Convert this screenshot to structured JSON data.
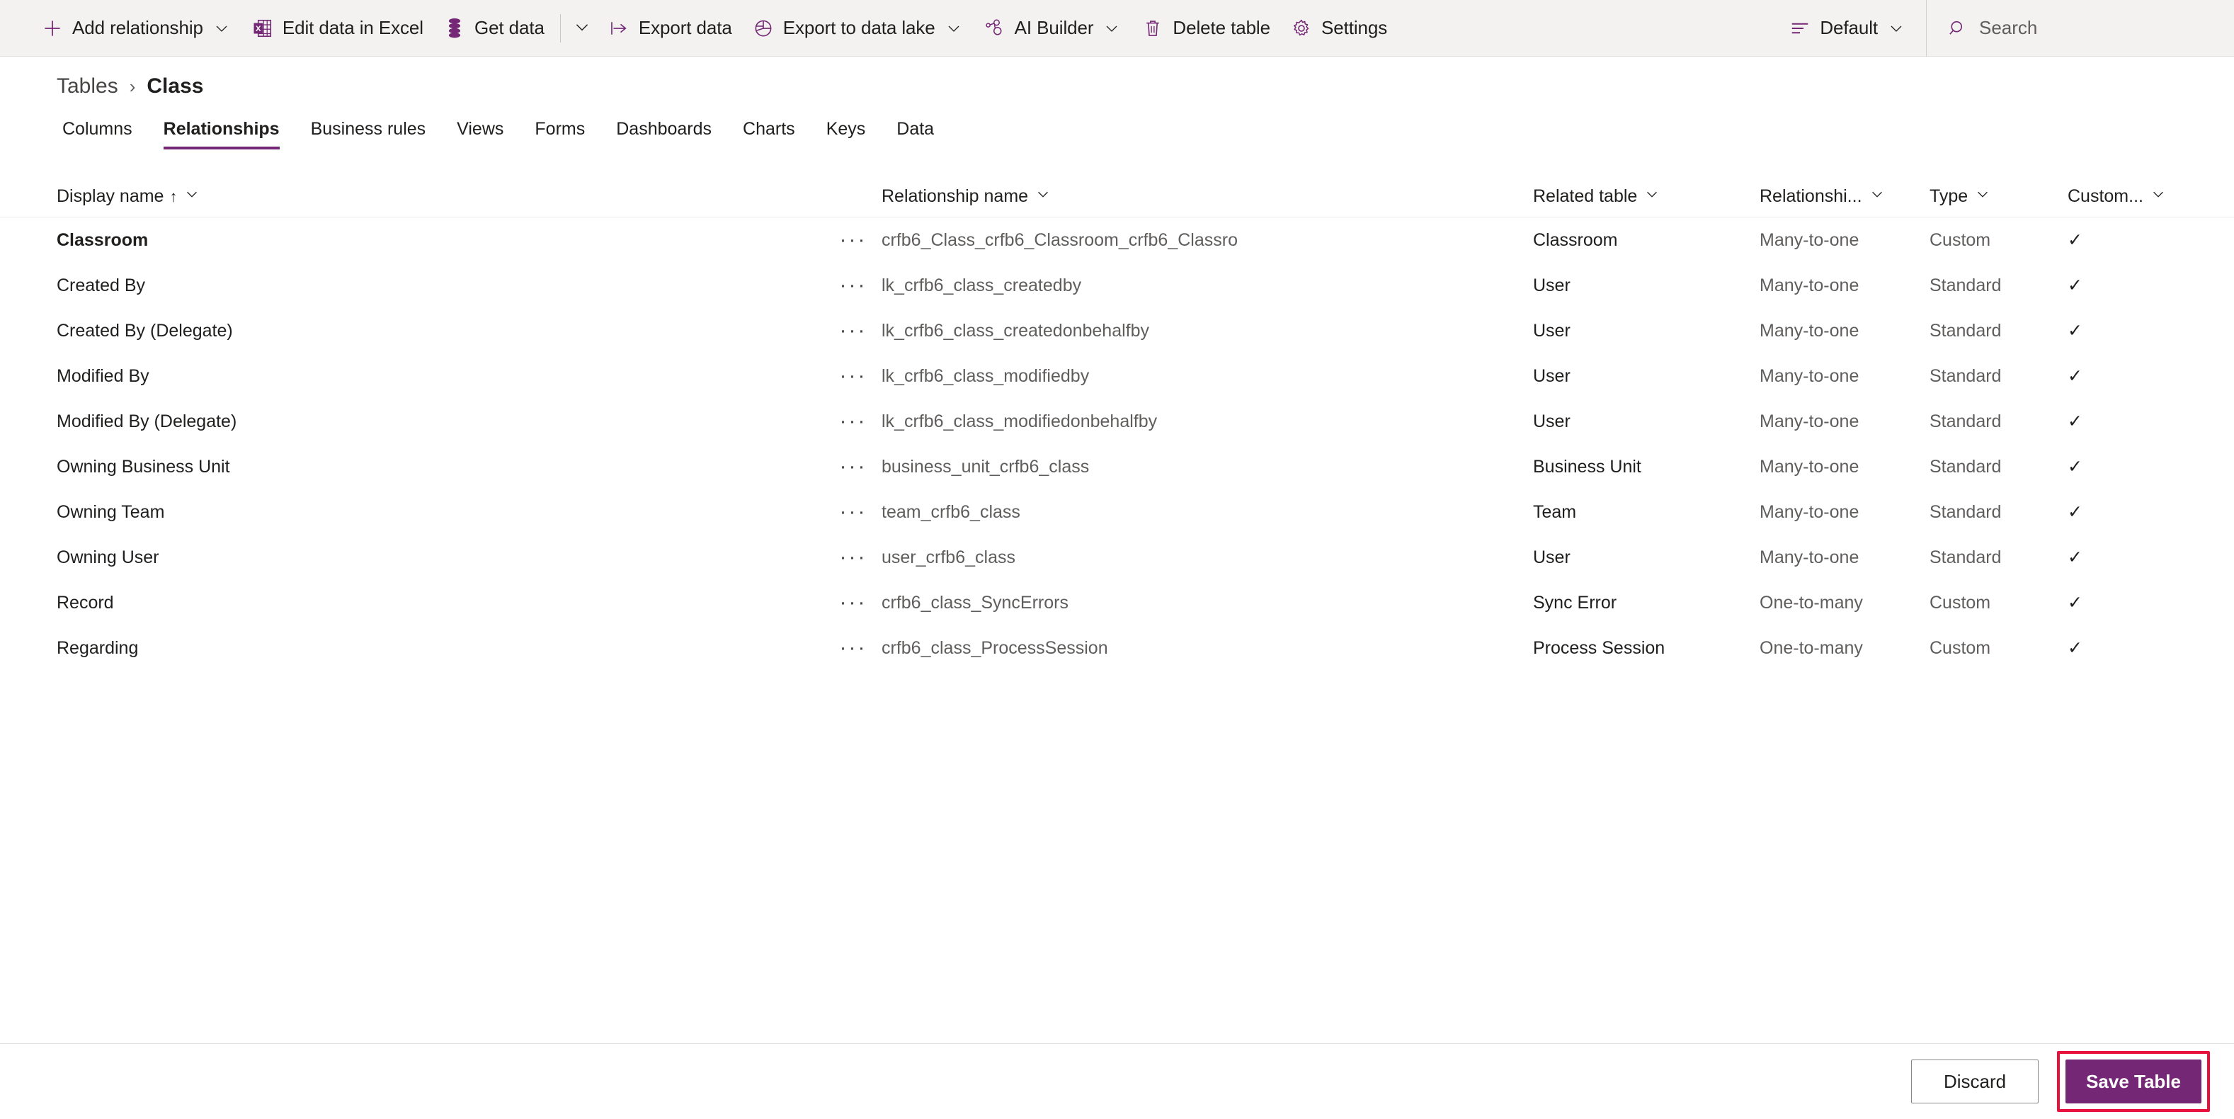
{
  "commandbar": {
    "items": [
      {
        "id": "add-relationship",
        "label": "Add relationship",
        "icon": "plus-icon",
        "has_chevron": true
      },
      {
        "id": "edit-data-in-excel",
        "label": "Edit data in Excel",
        "icon": "excel-icon",
        "has_chevron": false
      },
      {
        "id": "get-data",
        "label": "Get data",
        "icon": "database-icon",
        "has_chevron": false
      },
      {
        "id": "get-data-more",
        "label": "",
        "icon": "chevron-down-icon",
        "has_chevron": false
      },
      {
        "id": "export-data",
        "label": "Export data",
        "icon": "export-icon",
        "has_chevron": false
      },
      {
        "id": "export-to-data-lake",
        "label": "Export to data lake",
        "icon": "datalake-icon",
        "has_chevron": true
      },
      {
        "id": "ai-builder",
        "label": "AI Builder",
        "icon": "ai-builder-icon",
        "has_chevron": true
      },
      {
        "id": "delete-table",
        "label": "Delete table",
        "icon": "trash-icon",
        "has_chevron": false
      },
      {
        "id": "settings",
        "label": "Settings",
        "icon": "gear-icon",
        "has_chevron": false
      }
    ],
    "view_selector": {
      "label": "Default",
      "icon": "view-list-icon"
    },
    "search": {
      "placeholder": "Search",
      "icon": "search-icon",
      "value": ""
    }
  },
  "breadcrumb": {
    "parent": "Tables",
    "separator": "›",
    "current": "Class"
  },
  "tabs": [
    {
      "label": "Columns",
      "active": false
    },
    {
      "label": "Relationships",
      "active": true
    },
    {
      "label": "Business rules",
      "active": false
    },
    {
      "label": "Views",
      "active": false
    },
    {
      "label": "Forms",
      "active": false
    },
    {
      "label": "Dashboards",
      "active": false
    },
    {
      "label": "Charts",
      "active": false
    },
    {
      "label": "Keys",
      "active": false
    },
    {
      "label": "Data",
      "active": false
    }
  ],
  "grid": {
    "columns": [
      {
        "label": "Display name",
        "sorted": true,
        "sort_dir": "↑"
      },
      {
        "label": "Relationship name",
        "sorted": false,
        "sort_dir": ""
      },
      {
        "label": "Related table",
        "sorted": false,
        "sort_dir": ""
      },
      {
        "label": "Relationshi...",
        "sorted": false,
        "sort_dir": ""
      },
      {
        "label": "Type",
        "sorted": false,
        "sort_dir": ""
      },
      {
        "label": "Custom...",
        "sorted": false,
        "sort_dir": ""
      }
    ],
    "row_menu_glyph": "···",
    "check_glyph": "✓",
    "rows": [
      {
        "display_name": "Classroom",
        "bold": true,
        "relationship_name": "crfb6_Class_crfb6_Classroom_crfb6_Classro",
        "related_table": "Classroom",
        "relationship_type": "Many-to-one",
        "type": "Custom",
        "customizable": true
      },
      {
        "display_name": "Created By",
        "bold": false,
        "relationship_name": "lk_crfb6_class_createdby",
        "related_table": "User",
        "relationship_type": "Many-to-one",
        "type": "Standard",
        "customizable": true
      },
      {
        "display_name": "Created By (Delegate)",
        "bold": false,
        "relationship_name": "lk_crfb6_class_createdonbehalfby",
        "related_table": "User",
        "relationship_type": "Many-to-one",
        "type": "Standard",
        "customizable": true
      },
      {
        "display_name": "Modified By",
        "bold": false,
        "relationship_name": "lk_crfb6_class_modifiedby",
        "related_table": "User",
        "relationship_type": "Many-to-one",
        "type": "Standard",
        "customizable": true
      },
      {
        "display_name": "Modified By (Delegate)",
        "bold": false,
        "relationship_name": "lk_crfb6_class_modifiedonbehalfby",
        "related_table": "User",
        "relationship_type": "Many-to-one",
        "type": "Standard",
        "customizable": true
      },
      {
        "display_name": "Owning Business Unit",
        "bold": false,
        "relationship_name": "business_unit_crfb6_class",
        "related_table": "Business Unit",
        "relationship_type": "Many-to-one",
        "type": "Standard",
        "customizable": true
      },
      {
        "display_name": "Owning Team",
        "bold": false,
        "relationship_name": "team_crfb6_class",
        "related_table": "Team",
        "relationship_type": "Many-to-one",
        "type": "Standard",
        "customizable": true
      },
      {
        "display_name": "Owning User",
        "bold": false,
        "relationship_name": "user_crfb6_class",
        "related_table": "User",
        "relationship_type": "Many-to-one",
        "type": "Standard",
        "customizable": true
      },
      {
        "display_name": "Record",
        "bold": false,
        "relationship_name": "crfb6_class_SyncErrors",
        "related_table": "Sync Error",
        "relationship_type": "One-to-many",
        "type": "Custom",
        "customizable": true
      },
      {
        "display_name": "Regarding",
        "bold": false,
        "relationship_name": "crfb6_class_ProcessSession",
        "related_table": "Process Session",
        "relationship_type": "One-to-many",
        "type": "Custom",
        "customizable": true
      }
    ]
  },
  "footer": {
    "discard_label": "Discard",
    "save_label": "Save Table",
    "save_highlighted": true
  },
  "colors": {
    "accent_purple": "#742774",
    "commandbar_bg": "#f3f2f1",
    "highlight_red": "#e8113c",
    "text_primary": "#201f1e",
    "text_secondary": "#605e5c"
  }
}
